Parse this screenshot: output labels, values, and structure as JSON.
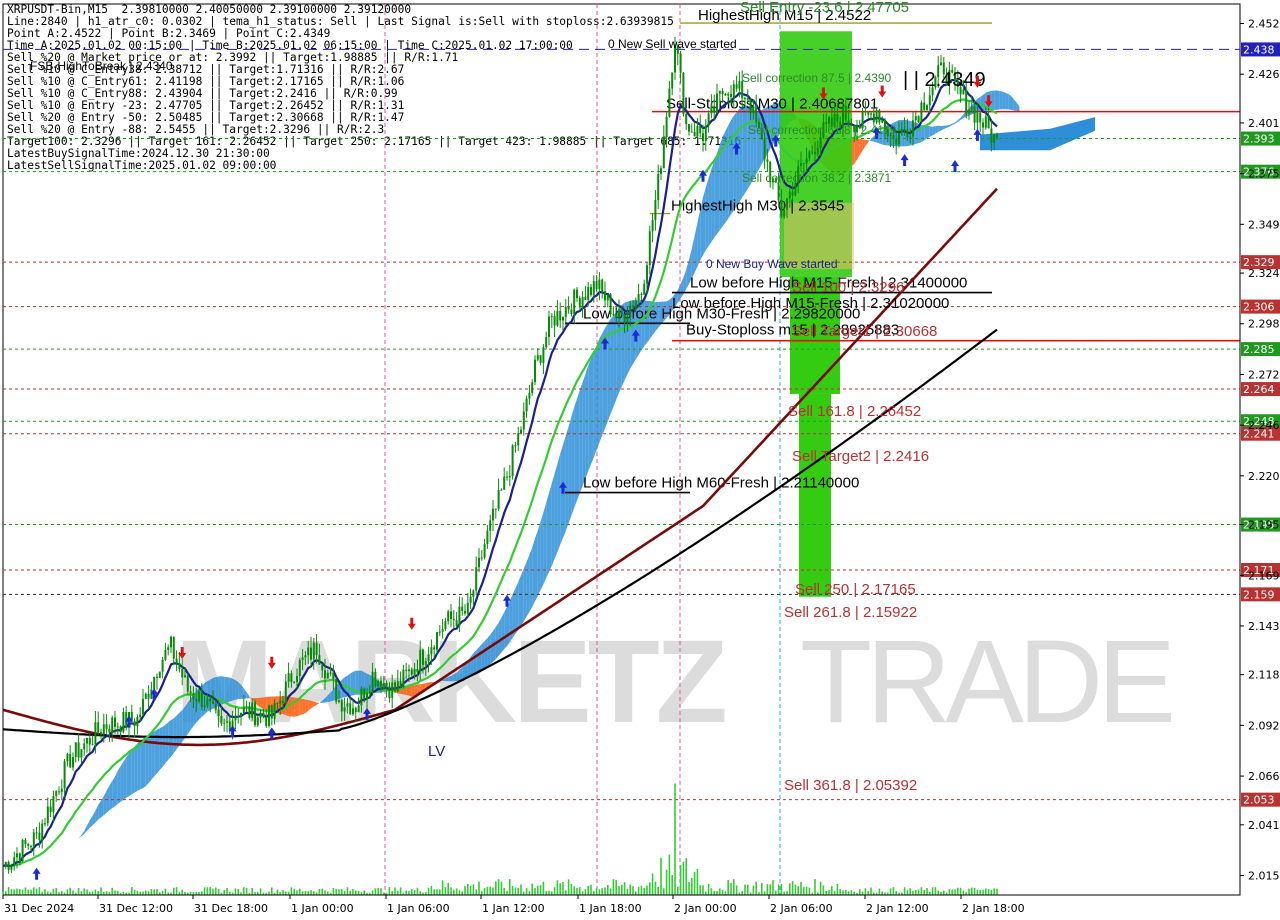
{
  "info_lines": [
    "XRPUSDT-Bin,M15  2.39810000 2.40050000 2.39100000 2.39120000",
    "Line:2840 | h1_atr_c0: 0.0302 | tema_h1_status: Sell | Last Signal is:Sell with stoploss:2.63939815",
    "Point A:2.4522 | Point B:2.3469 | Point C:2.4349",
    "Time A:2025.01.02 00:15:00 | Time B:2025.01.02 06:15:00 | Time C:2025.01.02 17:00:00",
    "Sell %20 @ Market price or at: 2.3992 || Target:1.98885 || R/R:1.71",
    "Sell %10 @ C_Entry38: 2.38712 || Target:1.71316 || R/R:2.67",
    "Sell %10 @ C_Entry61: 2.41198 || Target:2.17165 || R/R:1.06",
    "Sell %10 @ C_Entry88: 2.43904 || Target:2.2416 || R/R:0.99",
    "Sell %10 @ Entry -23: 2.47705 || Target:2.26452 || R/R:1.31",
    "Sell %20 @ Entry -50: 2.50485 || Target:2.30668 || R/R:1.47",
    "Sell %20 @ Entry -88: 2.5455 || Target:2.3296 || R/R:2.3",
    "Target100: 2.3296 || Target 161: 2.26452 || Target 250: 2.17165 || Target 423: 1.98885 || Target 685: 1.71316",
    "LatestBuySignalTime:2024.12.30 21:30:00",
    "LatestSellSignalTime:2025.01.02 09:00:00"
  ],
  "colors": {
    "background": "#ffffff",
    "candle": "#0a8a0a",
    "ema_fast": "#1b1f8f",
    "ema_mid": "#33cc33",
    "ema_slow": "#000000",
    "ema_long": "#7a0a0a",
    "cloud_blue": "#2e8fd8",
    "cloud_orange": "#ff5a0a",
    "sell_level": "#b83232",
    "buy_level": "#1f9a1f",
    "current_price_line": "#2222bb",
    "watermark": "#dcdcdc"
  },
  "watermark": {
    "part1": "MARKETZ",
    "part2": "TRADE"
  },
  "chart_data": {
    "type": "candlestick",
    "symbol": "XRPUSDT-Bin",
    "timeframe": "M15",
    "ylim": [
      2.005,
      2.462
    ],
    "yticks": [
      "2.452",
      "2.426",
      "2.401",
      "2.375",
      "2.349",
      "2.324",
      "2.298",
      "2.272",
      "2.246",
      "2.220",
      "2.195",
      "2.169",
      "2.143",
      "2.118",
      "2.092",
      "2.066",
      "2.041",
      "2.015"
    ],
    "x_labels": [
      "31 Dec 2024",
      "31 Dec 12:00",
      "31 Dec 18:00",
      "1 Jan 00:00",
      "1 Jan 06:00",
      "1 Jan 12:00",
      "1 Jan 18:00",
      "2 Jan 00:00",
      "2 Jan 06:00",
      "2 Jan 12:00",
      "2 Jan 18:00"
    ],
    "price_path": [
      [
        0,
        2.02
      ],
      [
        12,
        2.035
      ],
      [
        24,
        2.075
      ],
      [
        36,
        2.092
      ],
      [
        48,
        2.095
      ],
      [
        56,
        2.125
      ],
      [
        60,
        2.132
      ],
      [
        66,
        2.11
      ],
      [
        72,
        2.105
      ],
      [
        78,
        2.09
      ],
      [
        84,
        2.1
      ],
      [
        96,
        2.096
      ],
      [
        104,
        2.12
      ],
      [
        112,
        2.132
      ],
      [
        120,
        2.105
      ],
      [
        126,
        2.102
      ],
      [
        132,
        2.118
      ],
      [
        140,
        2.11
      ],
      [
        150,
        2.128
      ],
      [
        158,
        2.145
      ],
      [
        166,
        2.15
      ],
      [
        172,
        2.185
      ],
      [
        180,
        2.22
      ],
      [
        186,
        2.25
      ],
      [
        190,
        2.275
      ],
      [
        196,
        2.3
      ],
      [
        204,
        2.31
      ],
      [
        212,
        2.318
      ],
      [
        220,
        2.3
      ],
      [
        228,
        2.315
      ],
      [
        234,
        2.37
      ],
      [
        240,
        2.445
      ],
      [
        244,
        2.4
      ],
      [
        250,
        2.395
      ],
      [
        258,
        2.42
      ],
      [
        266,
        2.415
      ],
      [
        272,
        2.385
      ],
      [
        278,
        2.355
      ],
      [
        284,
        2.375
      ],
      [
        292,
        2.395
      ],
      [
        300,
        2.405
      ],
      [
        306,
        2.4
      ],
      [
        312,
        2.408
      ],
      [
        318,
        2.392
      ],
      [
        324,
        2.4
      ],
      [
        330,
        2.415
      ],
      [
        336,
        2.43
      ],
      [
        340,
        2.418
      ],
      [
        345,
        2.41
      ],
      [
        350,
        2.401
      ],
      [
        355,
        2.3912
      ]
    ],
    "current_price": 2.3912,
    "horizontal_levels": [
      {
        "price": 2.4522,
        "label": "HighestHigh   M15 | 2.4522",
        "kind": "high"
      },
      {
        "price": 2.4387,
        "label": "2.438",
        "kind": "current_blue"
      },
      {
        "price": 2.4068,
        "label": "Sell-Stoploss M30 | 2.40687801",
        "kind": "sell_stop"
      },
      {
        "price": 2.393,
        "label": "2.393",
        "kind": "buy"
      },
      {
        "price": 2.376,
        "label": "2.376",
        "kind": "buy"
      },
      {
        "price": 2.3545,
        "label": "HighestHigh   M30 | 2.3545",
        "kind": "high"
      },
      {
        "price": 2.3296,
        "label": "2.329",
        "kind": "sell"
      },
      {
        "price": 2.314,
        "label": "Low before High   M15-Fresh | 2.31400000",
        "kind": "low"
      },
      {
        "price": 2.3068,
        "label": "2.306",
        "kind": "sell"
      },
      {
        "price": 2.2982,
        "label": "Low before High   M30-Fresh | 2.29820000",
        "kind": "low"
      },
      {
        "price": 2.2893,
        "label": "Buy-Stoploss m15 | 2.28925883",
        "kind": "buy_stop"
      },
      {
        "price": 2.285,
        "label": "2.285",
        "kind": "buy"
      },
      {
        "price": 2.2645,
        "label": "2.264",
        "kind": "sell"
      },
      {
        "price": 2.248,
        "label": "2.248",
        "kind": "buy"
      },
      {
        "price": 2.2416,
        "label": "2.241",
        "kind": "sell"
      },
      {
        "price": 2.2114,
        "label": "Low before High   M60-Fresh | 2.21140000",
        "kind": "low"
      },
      {
        "price": 2.195,
        "label": "2.195",
        "kind": "buy"
      },
      {
        "price": 2.1717,
        "label": "2.171",
        "kind": "sell"
      },
      {
        "price": 2.1592,
        "label": "2.159",
        "kind": "sell_dark"
      },
      {
        "price": 2.0539,
        "label": "2.053",
        "kind": "sell"
      }
    ],
    "annotations": [
      {
        "text": "Sell Entry -23.6 | 2.47705",
        "color": "#2a8a2a"
      },
      {
        "text": "0 New Sell wave started",
        "color": "#000000"
      },
      {
        "text": "Sell correction 87.5 | 2.4390",
        "color": "#2a8a2a"
      },
      {
        "text": "| | 2.4349",
        "color": "#000000"
      },
      {
        "text": "Sell correction 61.8 | 2.4119",
        "color": "#2a8a2a"
      },
      {
        "text": "Sell correction 38.2 | 2.3871",
        "color": "#2a8a2a"
      },
      {
        "text": "0 New Buy Wave started",
        "color": "#1b1f8f"
      },
      {
        "text": "Sell 100 | 2.3296",
        "color": "#b83232"
      },
      {
        "text": "Low before High   M15-Fresh | 2.31020000",
        "color": "#000000"
      },
      {
        "text": "Sell Target1 | 2.30668",
        "color": "#b83232"
      },
      {
        "text": "Sell 161.8 | 2.26452",
        "color": "#b83232"
      },
      {
        "text": "Sell Target2 | 2.2416",
        "color": "#b83232"
      },
      {
        "text": "Sell 250 | 2.17165",
        "color": "#b83232"
      },
      {
        "text": "Sell  261.8 | 2.15922",
        "color": "#b83232"
      },
      {
        "text": "Sell  361.8 | 2.05392",
        "color": "#b83232"
      },
      {
        "text": "FSB-HighToBreak | 2.4340",
        "color": "#000000"
      },
      {
        "text": "LV",
        "color": "#1b1f8f"
      }
    ]
  }
}
